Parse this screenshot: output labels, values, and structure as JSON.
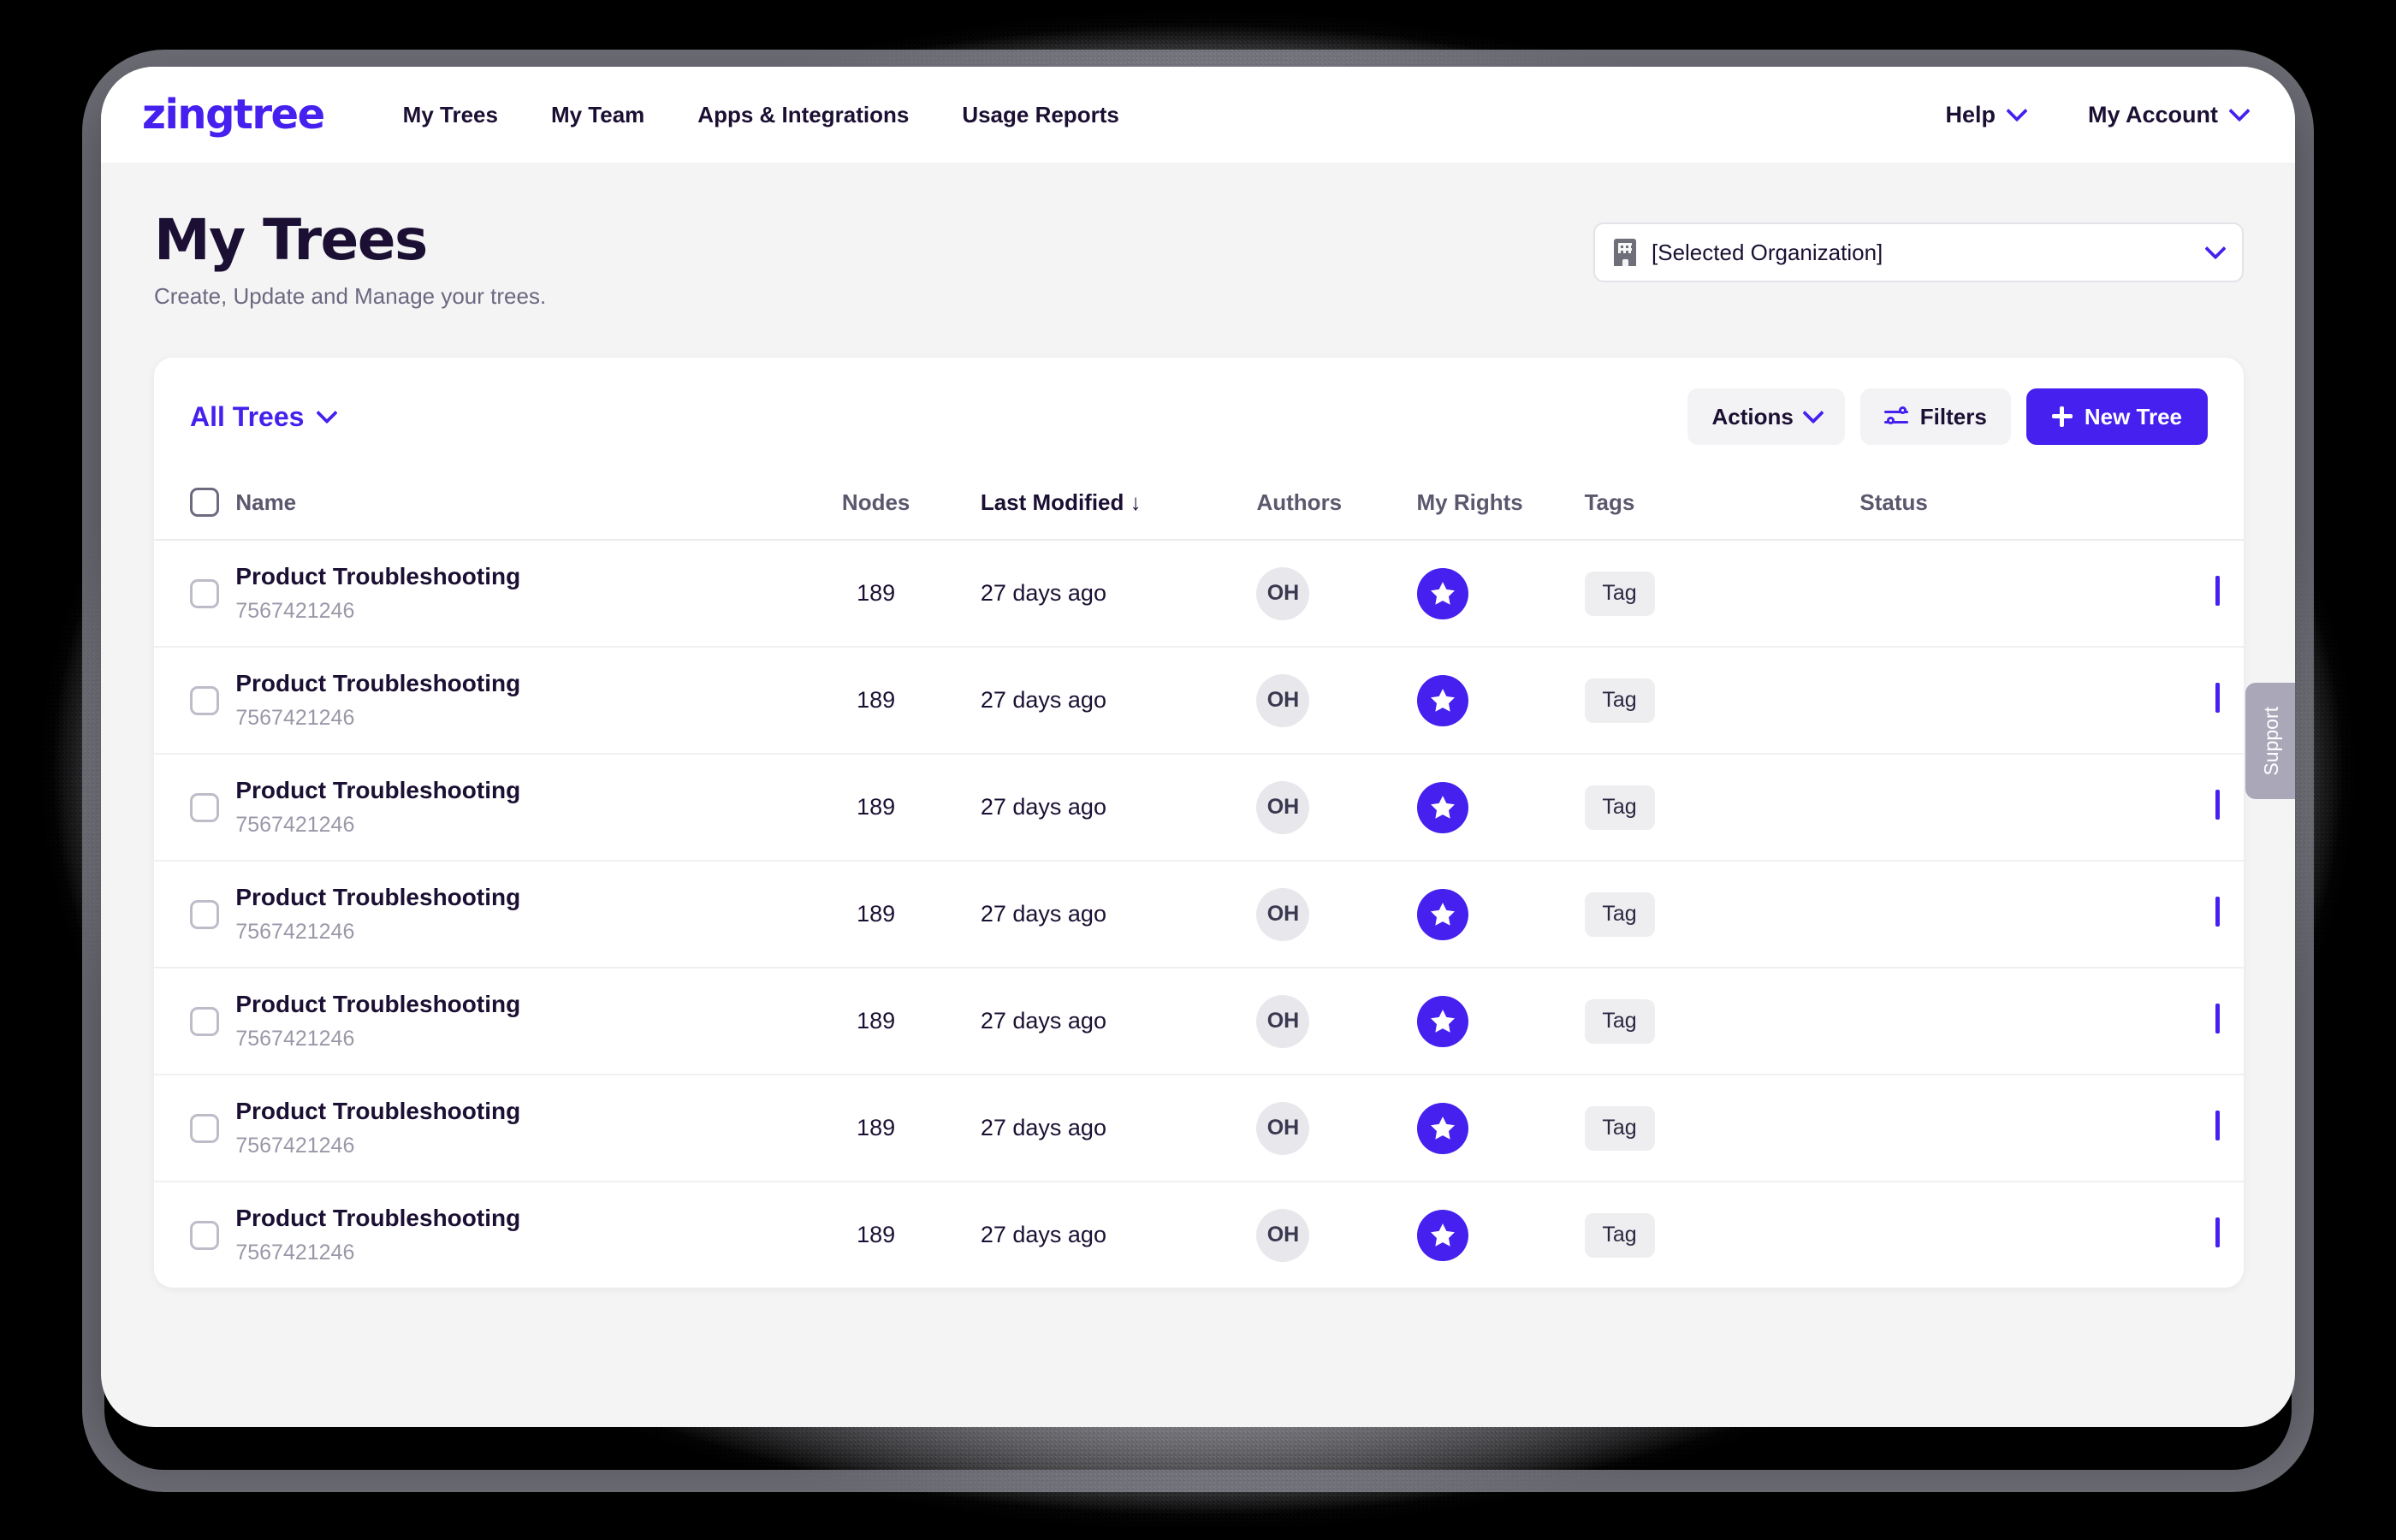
{
  "nav": {
    "logo": "zingtree",
    "links": [
      "My Trees",
      "My Team",
      "Apps & Integrations",
      "Usage Reports"
    ],
    "menus": [
      "Help",
      "My Account"
    ]
  },
  "page": {
    "title": "My Trees",
    "subtitle": "Create, Update and Manage your trees.",
    "org_selector": "[Selected Organization]"
  },
  "toolbar": {
    "filter_label": "All Trees",
    "actions_label": "Actions",
    "filters_label": "Filters",
    "new_tree_label": "New Tree"
  },
  "table": {
    "columns": [
      "Name",
      "Nodes",
      "Last Modified",
      "Authors",
      "My Rights",
      "Tags",
      "Status"
    ],
    "sort_column": "Last Modified",
    "sort_direction": "↓",
    "rows": [
      {
        "name": "Product Troubleshooting",
        "id": "7567421246",
        "nodes": "189",
        "modified": "27 days ago",
        "author": "OH",
        "rights": "star",
        "tag": "Tag",
        "status": ""
      },
      {
        "name": "Product Troubleshooting",
        "id": "7567421246",
        "nodes": "189",
        "modified": "27 days ago",
        "author": "OH",
        "rights": "star",
        "tag": "Tag",
        "status": ""
      },
      {
        "name": "Product Troubleshooting",
        "id": "7567421246",
        "nodes": "189",
        "modified": "27 days ago",
        "author": "OH",
        "rights": "star",
        "tag": "Tag",
        "status": ""
      },
      {
        "name": "Product Troubleshooting",
        "id": "7567421246",
        "nodes": "189",
        "modified": "27 days ago",
        "author": "OH",
        "rights": "star",
        "tag": "Tag",
        "status": ""
      },
      {
        "name": "Product Troubleshooting",
        "id": "7567421246",
        "nodes": "189",
        "modified": "27 days ago",
        "author": "OH",
        "rights": "star",
        "tag": "Tag",
        "status": ""
      },
      {
        "name": "Product Troubleshooting",
        "id": "7567421246",
        "nodes": "189",
        "modified": "27 days ago",
        "author": "OH",
        "rights": "star",
        "tag": "Tag",
        "status": ""
      },
      {
        "name": "Product Troubleshooting",
        "id": "7567421246",
        "nodes": "189",
        "modified": "27 days ago",
        "author": "OH",
        "rights": "star",
        "tag": "Tag",
        "status": ""
      }
    ]
  },
  "support": {
    "label": "Support"
  },
  "colors": {
    "accent": "#4520EE",
    "text_dark": "#1b1033",
    "text_muted": "#6b6880",
    "page_bg": "#f4f4f5",
    "badge_bg": "#e8e8ec"
  }
}
